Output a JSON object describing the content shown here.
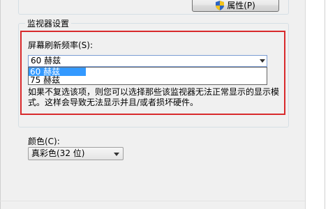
{
  "dialog": {
    "properties_button": "属性(P)",
    "monitor_group_title": "监视器设置",
    "refresh_label": "屏幕刷新频率(S):",
    "refresh_selected": "60 赫兹",
    "refresh_options": [
      "60 赫兹",
      "75 赫兹"
    ],
    "warning_text": "如果不复选该项，则您可以选择那些该监视器无法正常显示的显示模式。这样会导致无法显示并且/或者损坏硬件。",
    "color_label": "颜色(C):",
    "color_selected": "真彩色(32 位)"
  },
  "colors": {
    "highlight": "#d8292b",
    "selection": "#3399ff"
  },
  "icons": {
    "properties": "uac-shield-icon"
  }
}
